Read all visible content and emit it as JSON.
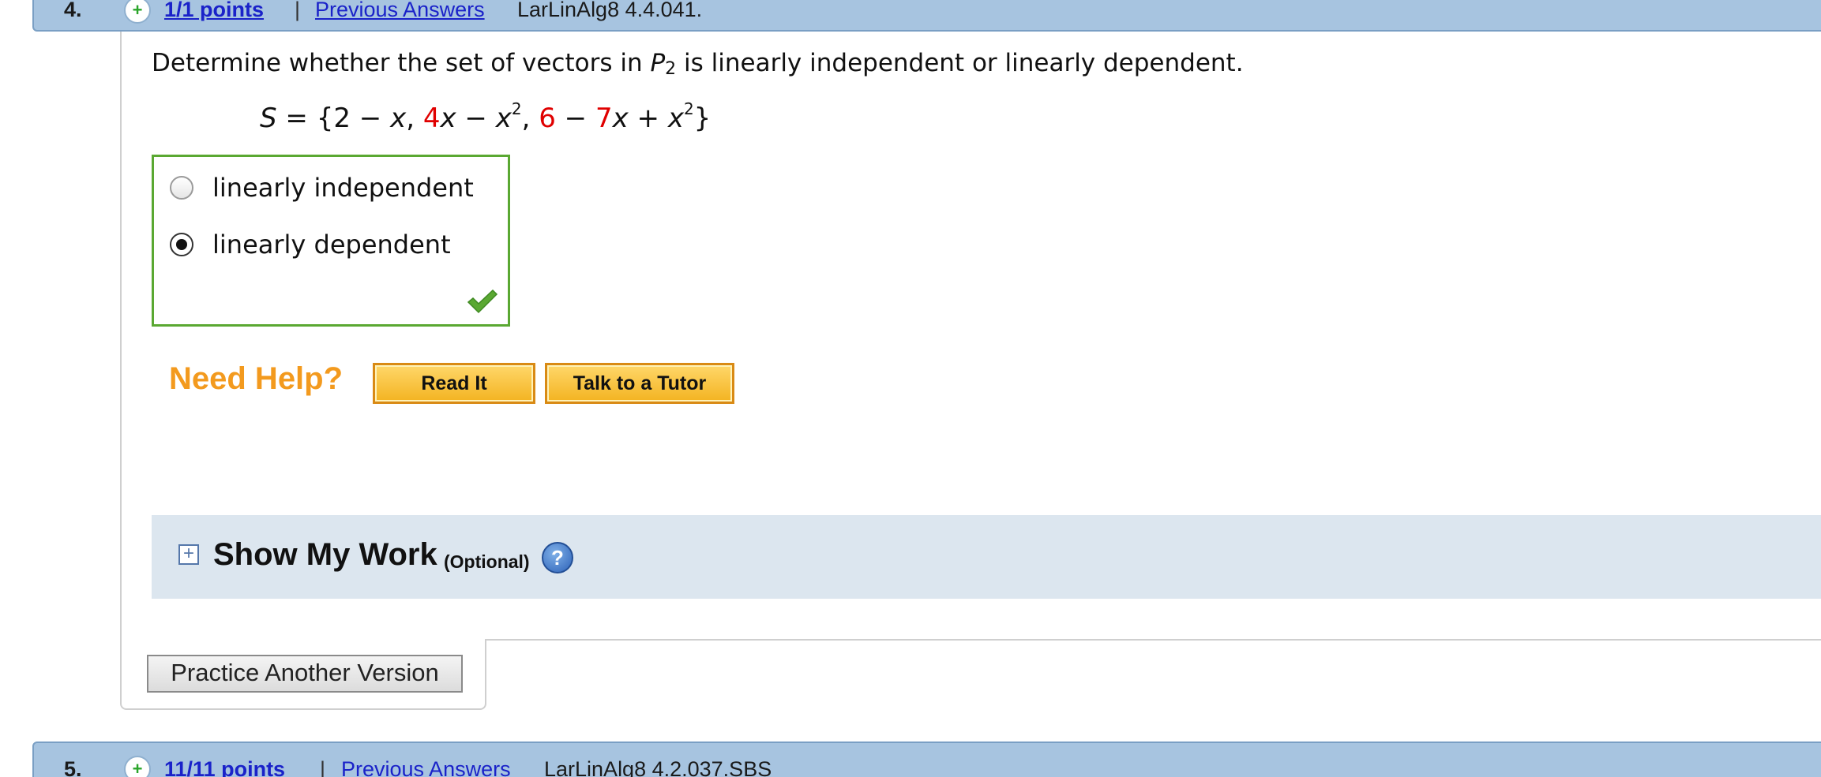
{
  "question_4": {
    "number": "4.",
    "points": "1/1 points",
    "separator": "|",
    "previous_answers": "Previous Answers",
    "code": "LarLinAlg8 4.4.041."
  },
  "prompt": {
    "before": "Determine whether the set of vectors in ",
    "space": "P",
    "space_sub": "2",
    "after": " is linearly independent or linearly dependent."
  },
  "equation": {
    "lhs": "S",
    "eq": " = {2 − ",
    "x1": "x",
    "comma1": ", ",
    "c1": "4",
    "x2": "x",
    "minus": " − ",
    "x3": "x",
    "exp1": "2",
    "comma2": ", ",
    "c2": "6",
    "minus2": " − ",
    "c3": "7",
    "x4": "x",
    "plus": " + ",
    "x5": "x",
    "exp2": "2",
    "close": "}"
  },
  "answers": {
    "options": [
      {
        "label": "linearly independent",
        "selected": false
      },
      {
        "label": "linearly dependent",
        "selected": true
      }
    ],
    "status_icon": "checkmark-icon",
    "box_color": "#5aa832"
  },
  "help": {
    "need_help": "Need Help?",
    "read_it": "Read It",
    "tutor": "Talk to a Tutor"
  },
  "show_work": {
    "title": "Show My Work",
    "optional": "(Optional)",
    "help_glyph": "?"
  },
  "practice": {
    "label": "Practice Another Version"
  },
  "question_5": {
    "number": "5.",
    "points": "11/11 points",
    "separator": "|",
    "previous_answers": "Previous Answers",
    "code": "LarLinAlg8 4.2.037.SBS"
  },
  "colors": {
    "header_bg": "#a7c4e0",
    "link": "#1a22c9",
    "need_help": "#f39a1e",
    "button_orange": "#f3b321",
    "show_work_bg": "#dce6ef",
    "emphasis_red": "#e00000"
  }
}
